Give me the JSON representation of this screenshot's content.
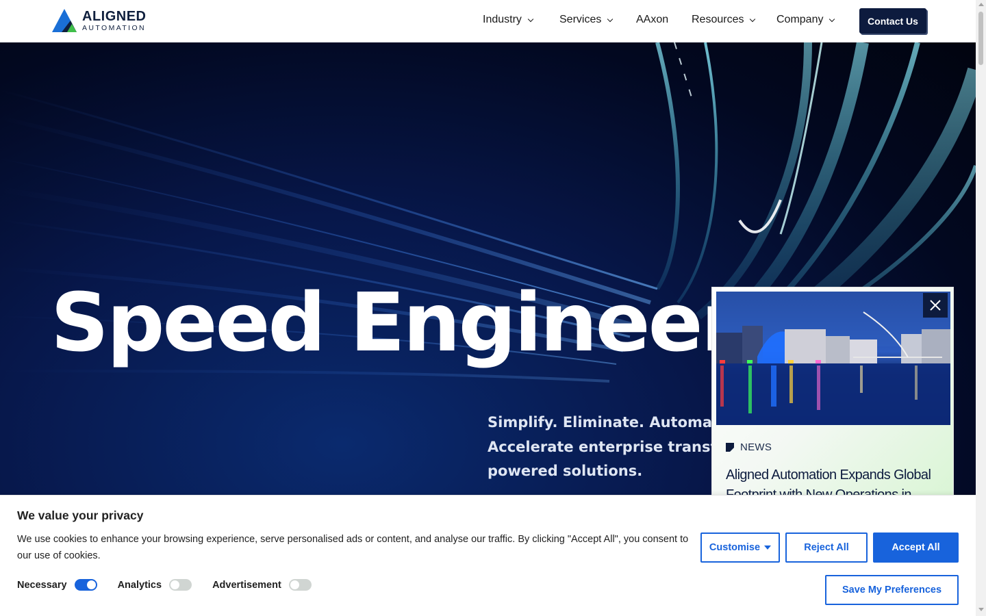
{
  "brand": {
    "name": "ALIGNED",
    "tagline": "AUTOMATION",
    "colors": {
      "navy": "#0f1f3d",
      "blue": "#1a6fd6",
      "green": "#3fbf4a"
    }
  },
  "nav": {
    "items": [
      {
        "label": "Industry",
        "has_dropdown": true
      },
      {
        "label": "Services",
        "has_dropdown": true
      },
      {
        "label": "AAxon",
        "has_dropdown": false
      },
      {
        "label": "Resources",
        "has_dropdown": true
      },
      {
        "label": "Company",
        "has_dropdown": true
      }
    ],
    "cta_label": "Contact Us"
  },
  "hero": {
    "title": "Speed Engineered",
    "subtitle_lines": [
      "Simplify. Eliminate. Automate.",
      "Accelerate enterprise transform",
      "powered solutions."
    ]
  },
  "news_popup": {
    "tag": "NEWS",
    "title": "Aligned Automation Expands Global Footprint with New Operations in",
    "close_icon": "close-icon"
  },
  "cookie_banner": {
    "title": "We value your privacy",
    "text": "We use cookies to enhance your browsing experience, serve personalised ads or content, and analyse our traffic. By clicking \"Accept All\", you consent to our use of cookies.",
    "toggles": [
      {
        "label": "Necessary",
        "on": true
      },
      {
        "label": "Analytics",
        "on": false
      },
      {
        "label": "Advertisement",
        "on": false
      }
    ],
    "buttons": {
      "customise": "Customise",
      "reject": "Reject All",
      "accept": "Accept All",
      "save": "Save My Preferences"
    },
    "accent_color": "#1863dc"
  }
}
